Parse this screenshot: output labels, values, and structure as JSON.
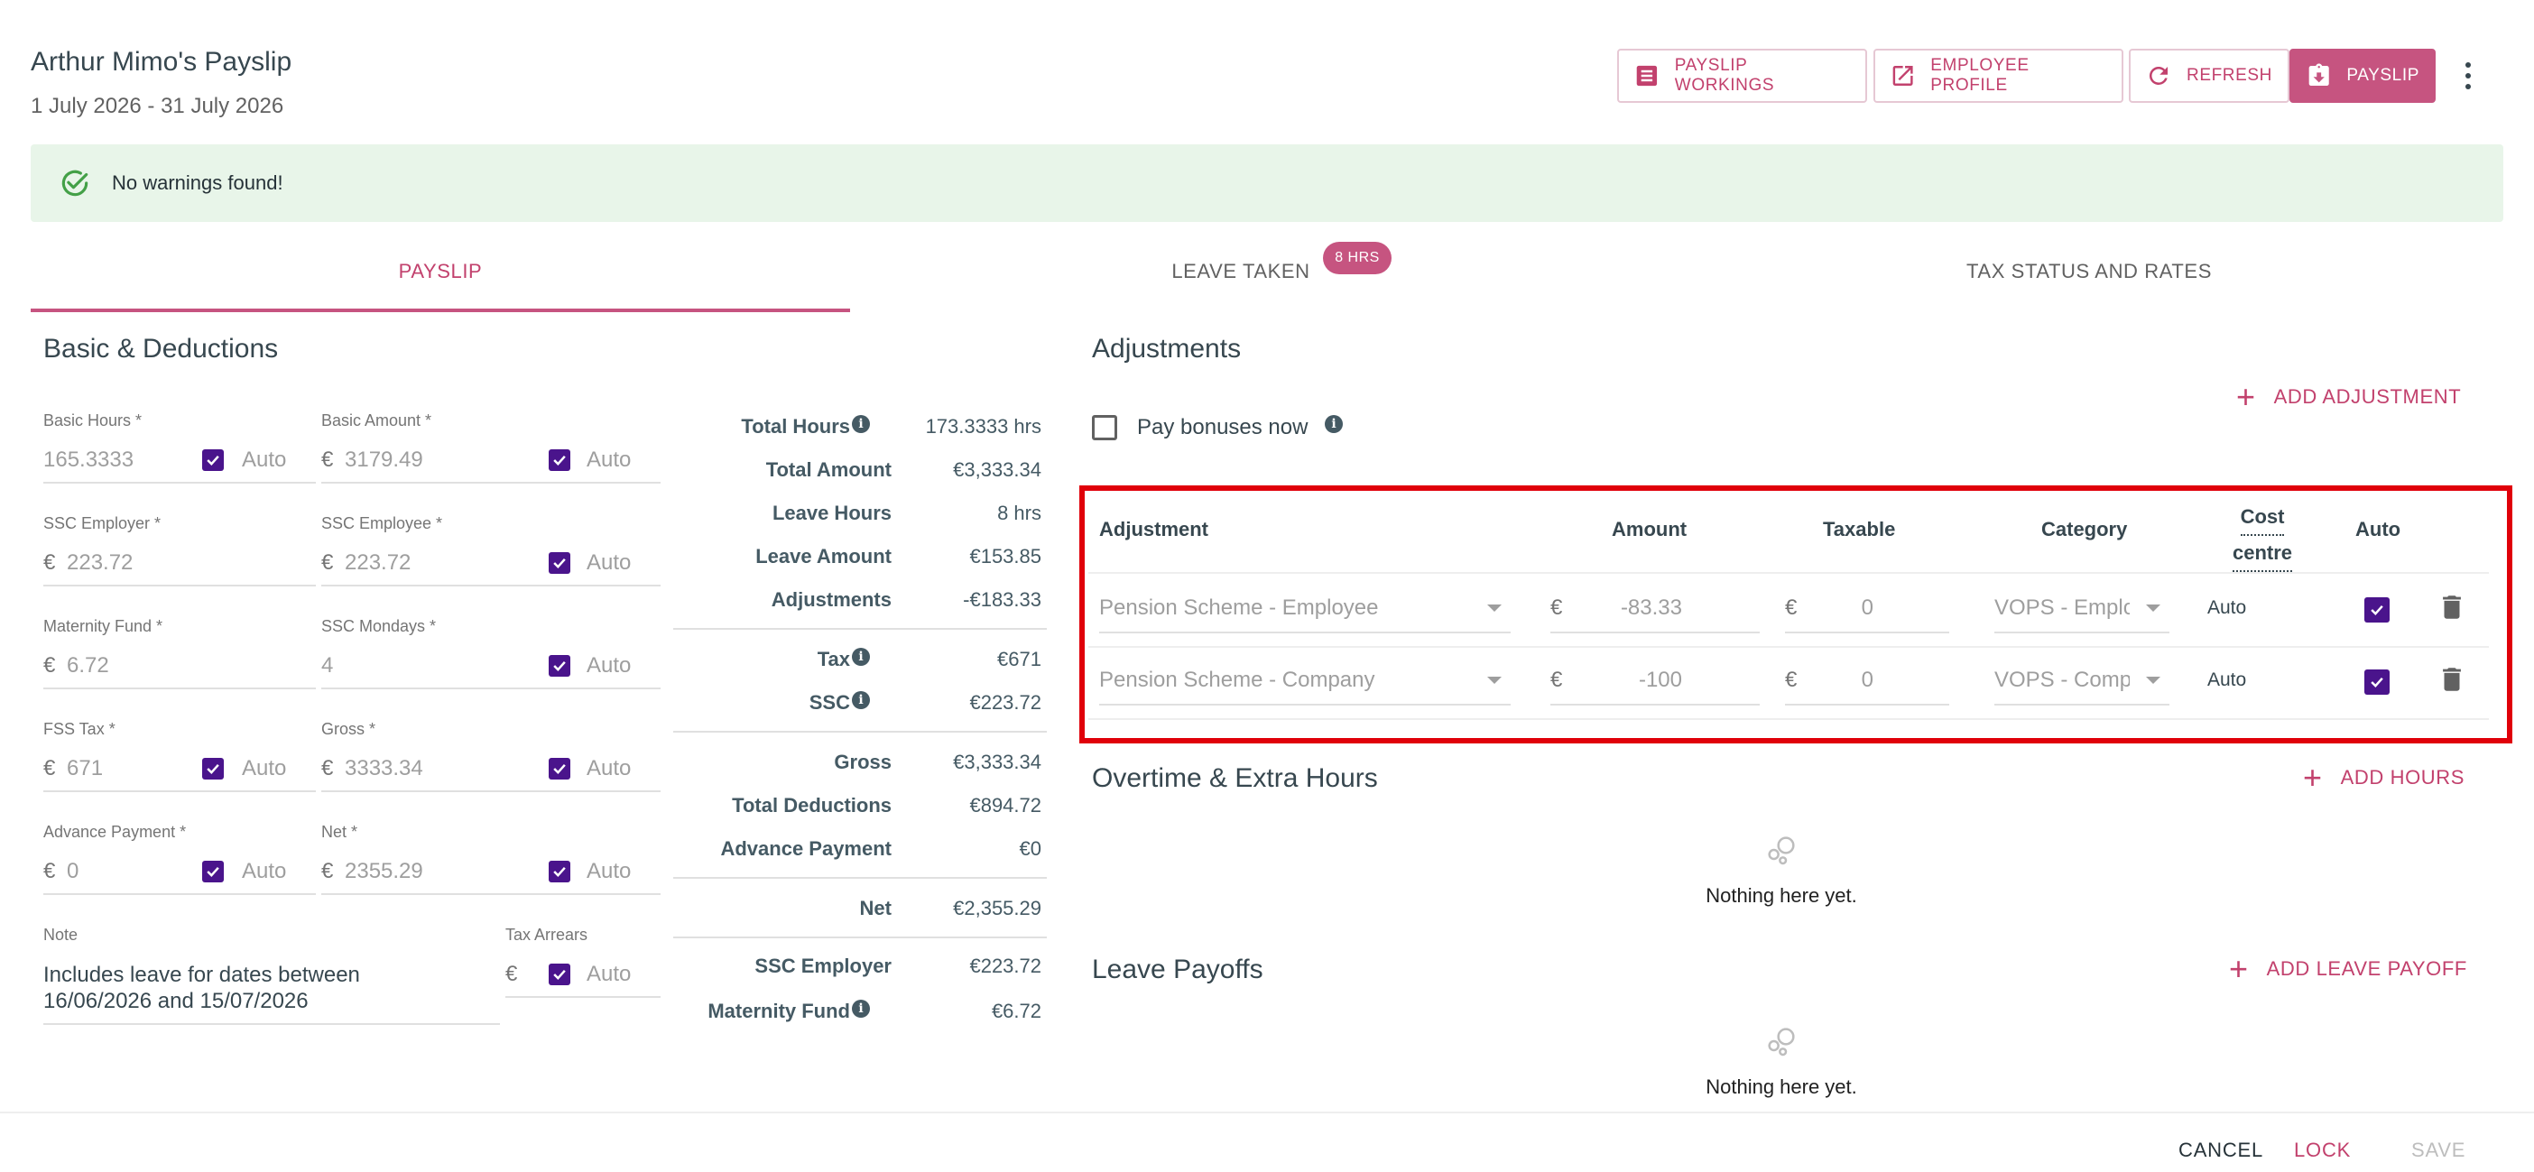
{
  "header": {
    "title": "Arthur Mimo's Payslip",
    "period": "1 July 2026 - 31 July 2026",
    "buttons": {
      "workings": "PAYSLIP WORKINGS",
      "profile": "EMPLOYEE PROFILE",
      "refresh": "REFRESH",
      "payslip": "PAYSLIP"
    }
  },
  "banner": {
    "text": "No warnings found!"
  },
  "tabs": {
    "payslip": "PAYSLIP",
    "leave": "LEAVE TAKEN",
    "leave_badge": "8 HRS",
    "tax": "TAX STATUS AND RATES"
  },
  "basic": {
    "title": "Basic & Deductions",
    "auto_label": "Auto",
    "currency": "€",
    "basic_hours": {
      "label": "Basic Hours *",
      "value": "165.3333"
    },
    "basic_amount": {
      "label": "Basic Amount *",
      "value": "3179.49"
    },
    "ssc_employer": {
      "label": "SSC Employer *",
      "value": "223.72"
    },
    "ssc_employee": {
      "label": "SSC Employee *",
      "value": "223.72"
    },
    "maternity_fund": {
      "label": "Maternity Fund *",
      "value": "6.72"
    },
    "ssc_mondays": {
      "label": "SSC Mondays *",
      "value": "4"
    },
    "fss_tax": {
      "label": "FSS Tax *",
      "value": "671"
    },
    "gross": {
      "label": "Gross *",
      "value": "3333.34"
    },
    "advance_payment": {
      "label": "Advance Payment *",
      "value": "0"
    },
    "net": {
      "label": "Net *",
      "value": "2355.29"
    },
    "note": {
      "label": "Note",
      "line1": "Includes leave for dates between",
      "line2": "16/06/2026 and 15/07/2026"
    },
    "tax_arrears": {
      "label": "Tax Arrears",
      "value": ""
    }
  },
  "summary": {
    "total_hours": {
      "label": "Total Hours",
      "value": "173.3333 hrs"
    },
    "total_amount": {
      "label": "Total Amount",
      "value": "€3,333.34"
    },
    "leave_hours": {
      "label": "Leave Hours",
      "value": "8 hrs"
    },
    "leave_amount": {
      "label": "Leave Amount",
      "value": "€153.85"
    },
    "adjustments": {
      "label": "Adjustments",
      "value": "-€183.33"
    },
    "tax": {
      "label": "Tax",
      "value": "€671"
    },
    "ssc": {
      "label": "SSC",
      "value": "€223.72"
    },
    "gross": {
      "label": "Gross",
      "value": "€3,333.34"
    },
    "total_deductions": {
      "label": "Total Deductions",
      "value": "€894.72"
    },
    "advance_payment": {
      "label": "Advance Payment",
      "value": "€0"
    },
    "net": {
      "label": "Net",
      "value": "€2,355.29"
    },
    "ssc_employer": {
      "label": "SSC Employer",
      "value": "€223.72"
    },
    "maternity_fund": {
      "label": "Maternity Fund",
      "value": "€6.72"
    }
  },
  "adjustments": {
    "title": "Adjustments",
    "add_label": "ADD ADJUSTMENT",
    "pay_bonuses": "Pay bonuses now",
    "headers": {
      "adjustment": "Adjustment",
      "amount": "Amount",
      "taxable": "Taxable",
      "category": "Category",
      "cost_line1": "Cost",
      "cost_line2": "centre",
      "auto": "Auto"
    },
    "rows": [
      {
        "name": "Pension Scheme - Employee",
        "currency": "€",
        "amount": "-83.33",
        "taxable": "0",
        "category": "VOPS - Emplo",
        "cost_centre": "Auto"
      },
      {
        "name": "Pension Scheme - Company",
        "currency": "€",
        "amount": "-100",
        "taxable": "0",
        "category": "VOPS - Comp",
        "cost_centre": "Auto"
      }
    ]
  },
  "overtime": {
    "title": "Overtime & Extra Hours",
    "add_label": "ADD HOURS",
    "empty": "Nothing here yet."
  },
  "leave_payoffs": {
    "title": "Leave Payoffs",
    "add_label": "ADD LEAVE PAYOFF",
    "empty": "Nothing here yet."
  },
  "footer": {
    "cancel": "CANCEL",
    "lock": "LOCK",
    "save": "SAVE"
  },
  "colors": {
    "accent": "#c65480",
    "checkbox": "#4a148c",
    "banner_bg": "#e8f5e9",
    "highlight": "#e0000a"
  }
}
